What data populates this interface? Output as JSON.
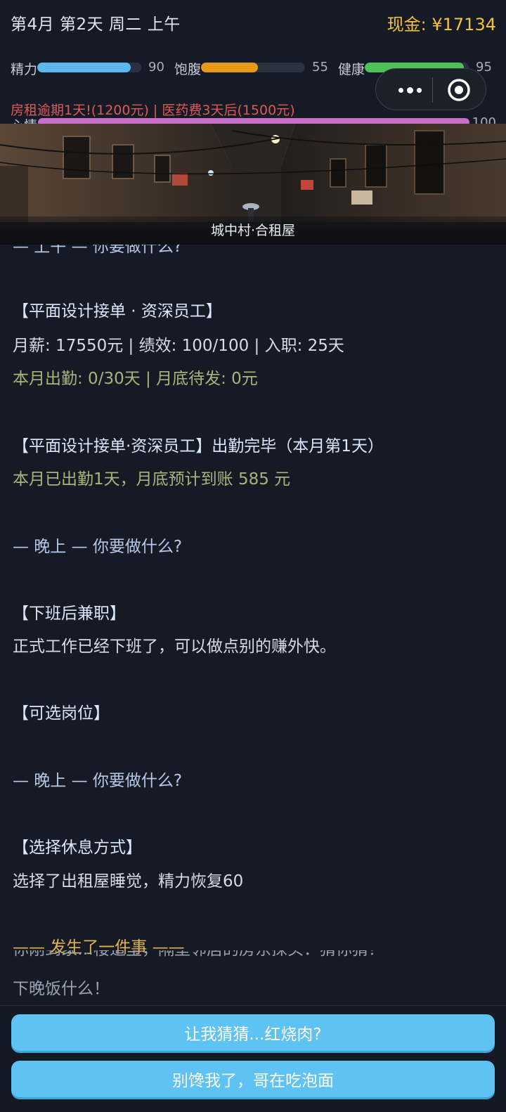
{
  "header": {
    "date": "第4月 第2天 周二 上午",
    "cash": "现金: ¥17134"
  },
  "stats": [
    {
      "label": "精力",
      "value": 90,
      "max": 100,
      "color": "#5ab8ee"
    },
    {
      "label": "饱腹",
      "value": 55,
      "max": 100,
      "color": "#e79a16"
    },
    {
      "label": "健康",
      "value": 95,
      "max": 100,
      "color": "#4cc35a"
    }
  ],
  "alert": "房租逾期1天!(1200元) | 医药费3天后(1500元)",
  "mood": {
    "label": "心情",
    "value": 100,
    "max": 100,
    "color": "#c76ec9"
  },
  "scene": {
    "caption": "城中村·合租屋"
  },
  "story_lines": [
    {
      "text": "— 上午 —  你要做什么?",
      "style": "prompt"
    },
    {
      "text": "【平面设计接单 · 资深员工】",
      "style": "title"
    },
    {
      "text": "月薪: 17550元 | 绩效: 100/100 | 入职: 25天",
      "style": "body"
    },
    {
      "text": "本月出勤: 0/30天 | 月底待发: 0元",
      "style": "green"
    },
    {
      "text": "【平面设计接单·资深员工】出勤完毕（本月第1天）",
      "style": "title"
    },
    {
      "text": "本月已出勤1天，月底预计到账 585 元",
      "style": "green"
    },
    {
      "text": "— 晚上 —  你要做什么?",
      "style": "prompt"
    },
    {
      "text": "【下班后兼职】",
      "style": "title"
    },
    {
      "text": "正式工作已经下班了，可以做点别的赚外快。",
      "style": "body"
    },
    {
      "text": "【可选岗位】",
      "style": "title"
    },
    {
      "text": "— 晚上 —  你要做什么?",
      "style": "prompt"
    },
    {
      "text": "【选择休息方式】",
      "style": "title"
    },
    {
      "text": "选择了出租屋睡觉，精力恢复60",
      "style": "body"
    },
    {
      "text": "—— 发生了一件事 ——",
      "style": "gold"
    }
  ],
  "event_preview": [
    "你刚到家…楼道里，隔壁邻居的房东探头：猜你猜？",
    "下晚饭什么！"
  ],
  "choices": [
    {
      "label": "让我猜猜...红烧肉?"
    },
    {
      "label": "别馋我了，哥在吃泡面"
    }
  ]
}
